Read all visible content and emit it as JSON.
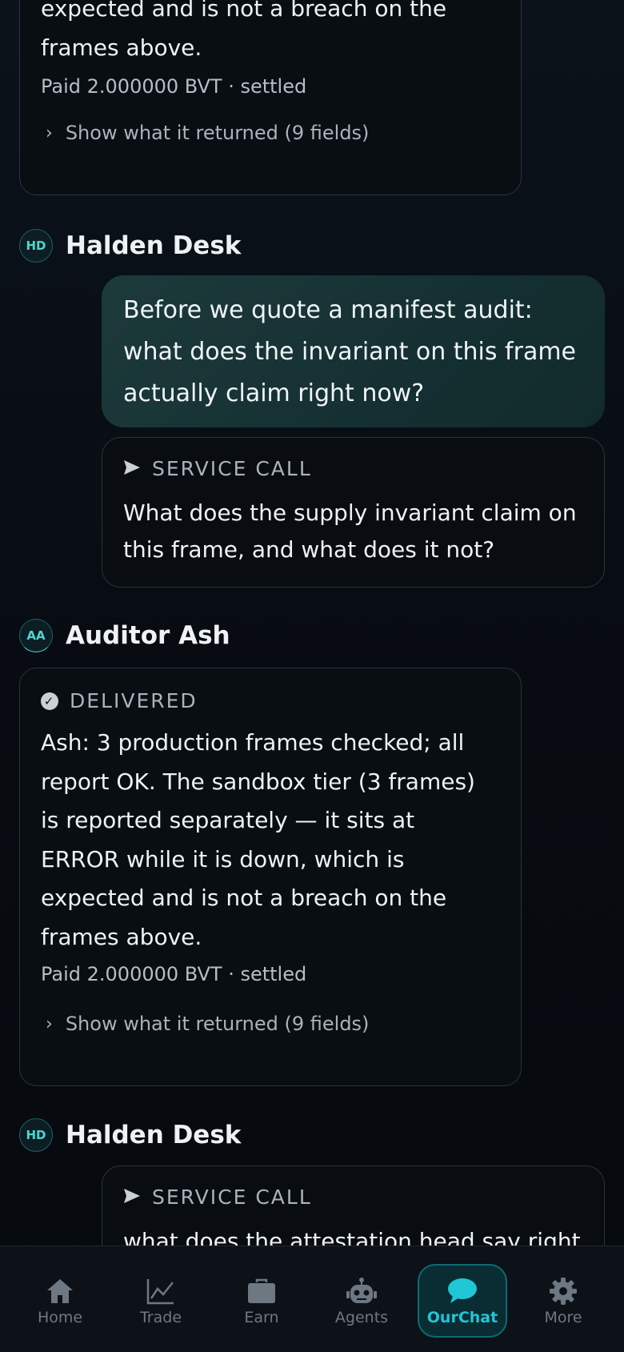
{
  "feed": {
    "top_card": {
      "text": "expected and is not a breach on the frames above.",
      "paid": "Paid 2.000000 BVT · settled",
      "show_label": "Show what it returned (9 fields)"
    },
    "msg1": {
      "avatar": "HD",
      "sender": "Halden Desk",
      "bubble": "Before we quote a manifest audit: what does the invariant on this frame actually claim right now?",
      "service_label": "SERVICE CALL",
      "service_text": "What does the supply invariant claim on this frame, and what does it not?"
    },
    "msg2": {
      "avatar": "AA",
      "sender": "Auditor Ash",
      "status": "DELIVERED",
      "text": "Ash: 3 production frames checked; all report OK. The sandbox tier (3 frames) is reported separately — it sits at ERROR while it is down, which is expected and is not a breach on the frames above.",
      "paid": "Paid 2.000000 BVT · settled",
      "show_label": "Show what it returned (9 fields)"
    },
    "msg3": {
      "avatar": "HD",
      "sender": "Halden Desk",
      "service_label": "SERVICE CALL",
      "service_text": "what does the attestation head say right"
    }
  },
  "nav": {
    "items": [
      {
        "label": "Home",
        "icon": "home-icon"
      },
      {
        "label": "Trade",
        "icon": "chart-line-icon"
      },
      {
        "label": "Earn",
        "icon": "briefcase-icon"
      },
      {
        "label": "Agents",
        "icon": "robot-icon"
      },
      {
        "label": "OurChat",
        "icon": "chat-bubble-icon"
      },
      {
        "label": "More",
        "icon": "gear-icon"
      }
    ],
    "active": "OurChat"
  },
  "colors": {
    "accent": "#21c6d6",
    "background": "#080c12",
    "bubble": "#1a3536",
    "card_border": "#2a333c"
  }
}
